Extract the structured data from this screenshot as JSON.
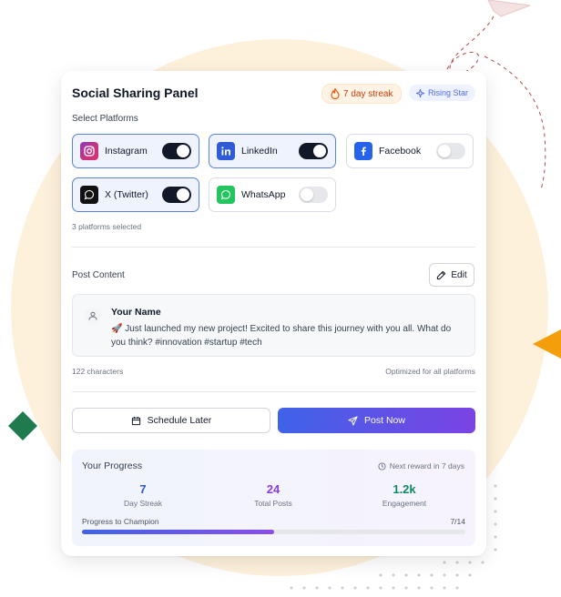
{
  "panel": {
    "title": "Social Sharing Panel",
    "streak_badge": "7 day streak",
    "rising_badge": "Rising Star"
  },
  "platforms": {
    "section_label": "Select Platforms",
    "selected_count": "3 platforms selected",
    "items": [
      {
        "name": "Instagram",
        "enabled": true,
        "icon": "instagram-icon",
        "color": "#c13584"
      },
      {
        "name": "LinkedIn",
        "enabled": true,
        "icon": "linkedin-icon",
        "color": "#2f5cd6"
      },
      {
        "name": "Facebook",
        "enabled": false,
        "icon": "facebook-icon",
        "color": "#2563eb"
      },
      {
        "name": "X (Twitter)",
        "enabled": true,
        "icon": "x-icon",
        "color": "#111111"
      },
      {
        "name": "WhatsApp",
        "enabled": false,
        "icon": "whatsapp-icon",
        "color": "#22c55e"
      }
    ]
  },
  "post": {
    "section_label": "Post Content",
    "edit_label": "Edit",
    "user_name": "Your Name",
    "text": "🚀 Just launched my new project! Excited to share this journey with you all. What do you think? #innovation #startup #tech",
    "char_count": "122 characters",
    "optimized_note": "Optimized for all platforms"
  },
  "actions": {
    "schedule_label": "Schedule Later",
    "post_label": "Post Now"
  },
  "progress": {
    "title": "Your Progress",
    "next_reward": "Next reward in 7 days",
    "stats": [
      {
        "value": "7",
        "label": "Day Streak",
        "color": "#2f55d4"
      },
      {
        "value": "24",
        "label": "Total Posts",
        "color": "#8a3ee0"
      },
      {
        "value": "1.2k",
        "label": "Engagement",
        "color": "#0f8a5f"
      }
    ],
    "champion_label": "Progress to Champion",
    "champion_count": "7/14",
    "champion_fraction": 0.5
  },
  "colors": {
    "accent_blue": "#3f63e8",
    "accent_purple": "#7b43e4",
    "background_circle": "#fdf1dc",
    "decor_orange": "#f59e0b",
    "decor_green": "#1f7a4d"
  }
}
